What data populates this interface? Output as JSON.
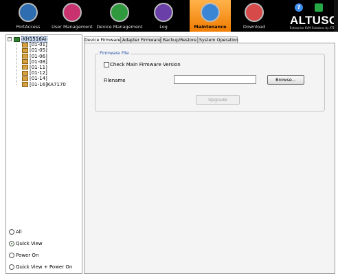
{
  "nav": {
    "items": [
      {
        "label": "PortAccess",
        "color": "#2e6db0"
      },
      {
        "label": "User Management",
        "color": "#c8326e"
      },
      {
        "label": "Device Management",
        "color": "#2f9a3d"
      },
      {
        "label": "Log",
        "color": "#6a3fa8"
      },
      {
        "label": "Maintenance",
        "color": "#3a86d4",
        "active": true
      },
      {
        "label": "Download",
        "color": "#d64a4a"
      }
    ]
  },
  "logo": {
    "brand": "ALTUSCN",
    "tagline": "Enterprise KVM Solutions by ATEN",
    "help_glyph": "?"
  },
  "tree": {
    "root": "KH1516Ai",
    "children": [
      "[01-01]",
      "[01-05]",
      "[01-06]",
      "[01-08]",
      "[01-11]",
      "[01-12]",
      "[01-14]",
      "[01-16]KA7170"
    ]
  },
  "view_options": [
    {
      "label": "All",
      "selected": false
    },
    {
      "label": "Quick View",
      "selected": true
    },
    {
      "label": "Power On",
      "selected": false
    },
    {
      "label": "Quick View + Power On",
      "selected": false
    }
  ],
  "tabs": [
    "Device Firmware",
    "Adapter Firmware",
    "Backup/Restore",
    "System Operation"
  ],
  "firmware": {
    "section_title": "Firmware File",
    "check_main_label": "Check Main Firmware Version",
    "filename_label": "Filename",
    "filename_value": "",
    "browse_label": "Browse...",
    "upgrade_label": "Upgrade"
  }
}
